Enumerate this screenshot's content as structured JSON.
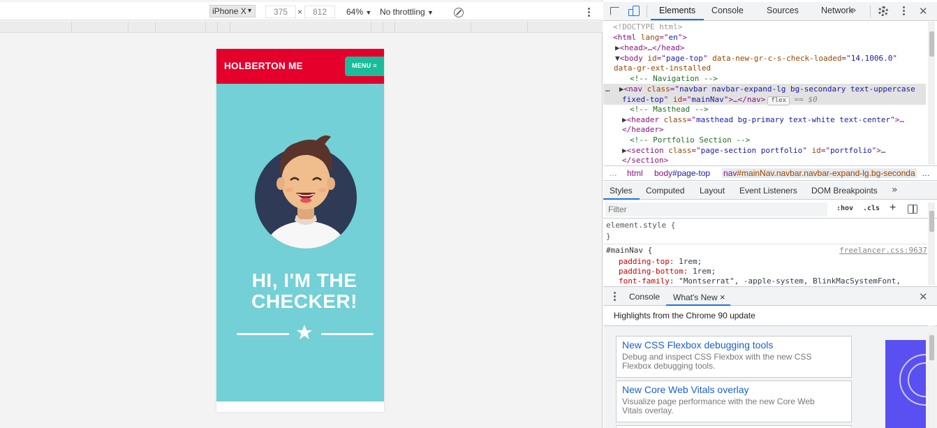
{
  "device_toolbar": {
    "device": "iPhone X",
    "width": "375",
    "height": "812",
    "times": "×",
    "zoom": "64%",
    "throttling": "No throttling",
    "dropdown_arrow": "▼"
  },
  "site": {
    "brand": "HOLBERTON ME",
    "menu_label": "MENU",
    "menu_glyph": "≡",
    "hero_line1": "HI, I'M THE",
    "hero_line2": "CHECKER!",
    "colors": {
      "nav": "#e4002b",
      "masthead": "#72d0d6",
      "menu_button": "#1abc9c"
    }
  },
  "devtools": {
    "tabs": [
      "Elements",
      "Console",
      "Sources",
      "Network"
    ],
    "more_tabs": "»",
    "dom": {
      "doctype": "<!DOCTYPE html>",
      "html_open": [
        "<html ",
        "lang",
        "=\"",
        "en",
        "\">"
      ],
      "head": [
        "<head>",
        "…",
        "</head>"
      ],
      "body_tag": "<body ",
      "body_attr1": "id",
      "body_val1": "page-top",
      "body_attr2": "data-new-gr-c-s-check-loaded",
      "body_val2": "14.1006.0",
      "body_attr3": "data-gr-ext-installed",
      "comment_nav": "<!-- Navigation -->",
      "nav_tag": "<nav ",
      "nav_class_attr": "class",
      "nav_class_val": "navbar navbar-expand-lg bg-secondary text-uppercase",
      "nav_class_val2": "fixed-top",
      "nav_id_attr": "id",
      "nav_id_val": "mainNav",
      "nav_close": "…</nav>",
      "flex_badge": "flex",
      "eq0": "== $0",
      "comment_masthead": "<!-- Masthead -->",
      "header_tag": "<header ",
      "header_class_attr": "class",
      "header_class_val": "masthead bg-primary text-white text-center",
      "header_close": "</header>",
      "comment_portfolio": "<!-- Portfolio Section -->",
      "section_tag": "<section ",
      "section_class_attr": "class",
      "section_class_val": "page-section portfolio",
      "section_id_attr": "id",
      "section_id_val": "portfolio",
      "section_close": "</section>",
      "ellipsis": "…"
    },
    "breadcrumbs": {
      "more": "…",
      "html": "html",
      "body_tag": "body",
      "body_id": "#page-top",
      "nav_tag": "nav",
      "nav_rest": "#mainNav.navbar.navbar-expand-lg.bg-seconda",
      "trailing": "…"
    },
    "styles_tabs": [
      "Styles",
      "Computed",
      "Layout",
      "Event Listeners",
      "DOM Breakpoints"
    ],
    "filter_placeholder": "Filter",
    "hov": ":hov",
    "cls": ".cls",
    "plus": "+",
    "rules": {
      "element_style": "element.style {",
      "close_brace": "}",
      "main_nav_selector": "#mainNav {",
      "source": "freelancer.css:9637",
      "props": [
        {
          "name": "padding-top",
          "value": "1rem;"
        },
        {
          "name": "padding-bottom",
          "value": "1rem;"
        },
        {
          "name": "font-family",
          "value": "\"Montserrat\", -apple-system, BlinkMacSystemFont,"
        }
      ]
    },
    "drawer": {
      "tabs": [
        "Console",
        "What's New"
      ],
      "close_tab": "×",
      "headline": "Highlights from the Chrome 90 update",
      "cards": [
        {
          "title": "New CSS Flexbox debugging tools",
          "desc_1": "Debug and inspect CSS Flexbox with the new CSS",
          "desc_2": "Flexbox debugging tools."
        },
        {
          "title": "New Core Web Vitals overlay",
          "desc_1": "Visualize page performance with the new Core Web",
          "desc_2": "Vitals overlay."
        }
      ]
    },
    "close": "✕",
    "icons": [
      "select-element-icon",
      "device-toggle-icon",
      "settings-icon",
      "kebab-menu-icon",
      "close-icon",
      "rotate-icon"
    ]
  }
}
